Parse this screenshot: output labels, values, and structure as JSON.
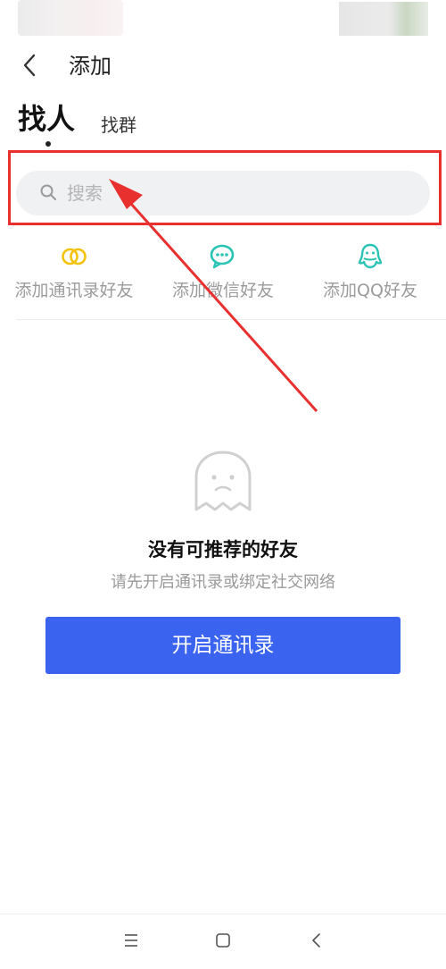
{
  "header": {
    "title": "添加"
  },
  "tabs": [
    {
      "label": "找人",
      "active": true
    },
    {
      "label": "找群",
      "active": false
    }
  ],
  "search": {
    "placeholder": "搜索"
  },
  "shortcuts": [
    {
      "label": "添加通讯录好友",
      "icon": "contacts-rings-icon",
      "color": "#f3c20c"
    },
    {
      "label": "添加微信好友",
      "icon": "wechat-icon",
      "color": "#2bc3b4"
    },
    {
      "label": "添加QQ好友",
      "icon": "qq-icon",
      "color": "#2bc3b4"
    }
  ],
  "empty_state": {
    "title": "没有可推荐的好友",
    "description": "请先开启通讯录或绑定社交网络",
    "icon": "ghost-icon"
  },
  "primary_action": {
    "label": "开启通讯录"
  },
  "annotation": {
    "highlight_color": "#e8302f"
  },
  "system_nav": {
    "items": [
      "menu-icon",
      "home-icon",
      "back-icon"
    ]
  },
  "colors": {
    "accent": "#3a63f0"
  }
}
